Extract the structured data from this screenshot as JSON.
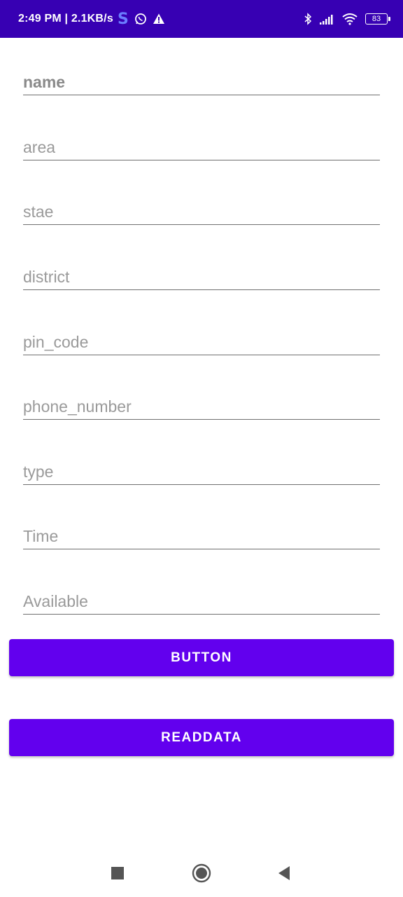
{
  "status_bar": {
    "time_speed": "2:49 PM | 2.1KB/s",
    "app_letter": "S",
    "battery": "83"
  },
  "form": {
    "fields": [
      {
        "placeholder": "name"
      },
      {
        "placeholder": "area"
      },
      {
        "placeholder": "stae"
      },
      {
        "placeholder": "district"
      },
      {
        "placeholder": "pin_code"
      },
      {
        "placeholder": "phone_number"
      },
      {
        "placeholder": "type"
      },
      {
        "placeholder": "Time"
      },
      {
        "placeholder": "Available"
      }
    ],
    "button_label": "BUTTON",
    "readdata_label": "READDATA"
  },
  "colors": {
    "status_bar": "#3700b3",
    "button": "#6200ee"
  },
  "icons": {
    "status": [
      "s-app-icon",
      "whatsapp-icon",
      "warning-icon",
      "bluetooth-icon",
      "signal-icon",
      "wifi-icon",
      "battery-icon"
    ],
    "navigation": [
      "recents-square-icon",
      "home-circle-icon",
      "back-triangle-icon"
    ]
  }
}
